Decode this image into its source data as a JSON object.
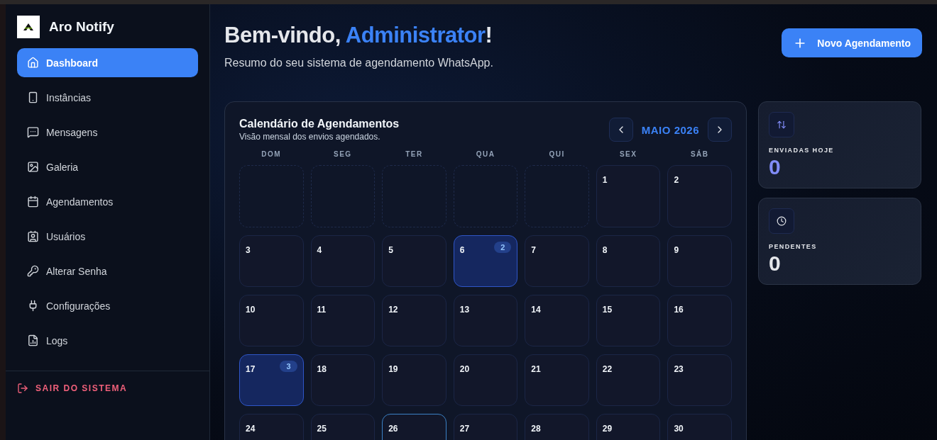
{
  "sidebar": {
    "brand": "Aro Notify",
    "items": [
      {
        "label": "Dashboard",
        "selected": true
      },
      {
        "label": "Instâncias",
        "selected": false
      },
      {
        "label": "Mensagens",
        "selected": false
      },
      {
        "label": "Galeria",
        "selected": false
      },
      {
        "label": "Agendamentos",
        "selected": false
      },
      {
        "label": "Usuários",
        "selected": false
      },
      {
        "label": "Alterar Senha",
        "selected": false
      },
      {
        "label": "Configurações",
        "selected": false
      },
      {
        "label": "Logs",
        "selected": false
      }
    ],
    "logout": "SAIR DO SISTEMA"
  },
  "header": {
    "greeting": "Bem-vindo, ",
    "name": "Administrator",
    "suffix": "!",
    "subtitle": "Resumo do seu sistema de agendamento WhatsApp.",
    "new_button": "Novo Agendamento"
  },
  "calendar": {
    "title": "Calendário de Agendamentos",
    "subtitle": "Visão mensal dos envios agendados.",
    "month": "MAIO 2026",
    "weekdays": [
      "DOM",
      "SEG",
      "TER",
      "QUA",
      "QUI",
      "SEX",
      "SÁB"
    ],
    "cells": [
      {
        "kind": "empty"
      },
      {
        "kind": "empty"
      },
      {
        "kind": "empty"
      },
      {
        "kind": "empty"
      },
      {
        "kind": "empty"
      },
      {
        "kind": "day",
        "day": "1",
        "today": false
      },
      {
        "kind": "day",
        "day": "2",
        "today": false
      },
      {
        "kind": "day",
        "day": "3",
        "today": false
      },
      {
        "kind": "day",
        "day": "4",
        "today": false
      },
      {
        "kind": "day",
        "day": "5",
        "today": false
      },
      {
        "kind": "day",
        "day": "6",
        "today": false,
        "count": "2"
      },
      {
        "kind": "day",
        "day": "7",
        "today": false
      },
      {
        "kind": "day",
        "day": "8",
        "today": false
      },
      {
        "kind": "day",
        "day": "9",
        "today": false
      },
      {
        "kind": "day",
        "day": "10",
        "today": false
      },
      {
        "kind": "day",
        "day": "11",
        "today": false
      },
      {
        "kind": "day",
        "day": "12",
        "today": false
      },
      {
        "kind": "day",
        "day": "13",
        "today": false
      },
      {
        "kind": "day",
        "day": "14",
        "today": false
      },
      {
        "kind": "day",
        "day": "15",
        "today": false
      },
      {
        "kind": "day",
        "day": "16",
        "today": false
      },
      {
        "kind": "day",
        "day": "17",
        "today": false,
        "count": "3"
      },
      {
        "kind": "day",
        "day": "18",
        "today": false
      },
      {
        "kind": "day",
        "day": "19",
        "today": false
      },
      {
        "kind": "day",
        "day": "20",
        "today": false
      },
      {
        "kind": "day",
        "day": "21",
        "today": false
      },
      {
        "kind": "day",
        "day": "22",
        "today": false
      },
      {
        "kind": "day",
        "day": "23",
        "today": false
      },
      {
        "kind": "day",
        "day": "24",
        "today": false
      },
      {
        "kind": "day",
        "day": "25",
        "today": false
      },
      {
        "kind": "day",
        "day": "26",
        "today": true
      },
      {
        "kind": "day",
        "day": "27",
        "today": false
      },
      {
        "kind": "day",
        "day": "28",
        "today": false
      },
      {
        "kind": "day",
        "day": "29",
        "today": false
      },
      {
        "kind": "day",
        "day": "30",
        "today": false
      }
    ]
  },
  "stats": [
    {
      "label": "ENVIADAS HOJE",
      "value": "0",
      "color": "#818cf8"
    },
    {
      "label": "PENDENTES",
      "value": "0",
      "color": "#e5e7eb"
    }
  ]
}
